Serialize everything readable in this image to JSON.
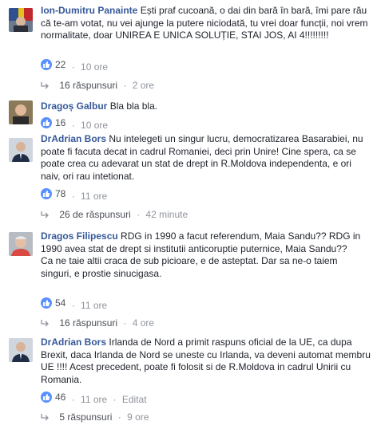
{
  "comments": [
    {
      "author": "Ion-Dumitru Panainte",
      "text": "Ești praf cucoană, o dai din bară în bară, îmi pare rău că te-am votat, nu vei ajunge la putere niciodată, tu vrei doar funcții, noi vrem normalitate, doar UNIREA E UNICA SOLUȚIE, STAI JOS, AI 4!!!!!!!!!",
      "reactions": "22",
      "time": "10 ore",
      "replies": "16 răspunsuri",
      "reply_time": "2 ore"
    },
    {
      "author": "Dragoș Galbur",
      "text": "Bla bla bla.",
      "reactions": "16",
      "time": "10 ore"
    },
    {
      "author": "DrAdrian Bors",
      "text": "Nu intelegeti un singur lucru, democratizarea Basarabiei, nu poate fi facuta decat in cadrul Romaniei, deci prin Unire! Cine spera, ca se poate crea cu adevarat un stat de drept in R.Moldova independenta, e ori naiv, ori rau intetionat.",
      "reactions": "78",
      "time": "11 ore",
      "replies": "26 de răspunsuri",
      "reply_time": "42 minute"
    },
    {
      "author": "Dragos Filipescu",
      "text": "RDG in 1990 a facut referendum, Maia Sandu?? RDG in 1990 avea stat de drept si institutii anticoruptie puternice, Maia Sandu??",
      "text2": "Ca ne taie altii craca de sub picioare, e de asteptat. Dar sa ne-o taiem singuri, e prostie sinucigasa.",
      "reactions": "54",
      "time": "11 ore",
      "replies": "16 răspunsuri",
      "reply_time": "4 ore"
    },
    {
      "author": "DrAdrian Bors",
      "text": "Irlanda de Nord a primit raspuns oficial de la UE, ca dupa Brexit, daca Irlanda de Nord se uneste cu Irlanda, va deveni automat membru UE !!!! Acest precedent, poate fi folosit si de R.Moldova in cadrul Unirii cu Romania.",
      "reactions": "46",
      "time": "11 ore",
      "edited": "Editat",
      "replies": "5 răspunsuri",
      "reply_time": "9 ore"
    }
  ],
  "separator": "·",
  "colors": {
    "author": "#365899",
    "meta": "#90949c",
    "like": "#5890ff"
  },
  "icons": {
    "like": "thumbs-up-icon",
    "reply": "reply-arrow-icon"
  }
}
